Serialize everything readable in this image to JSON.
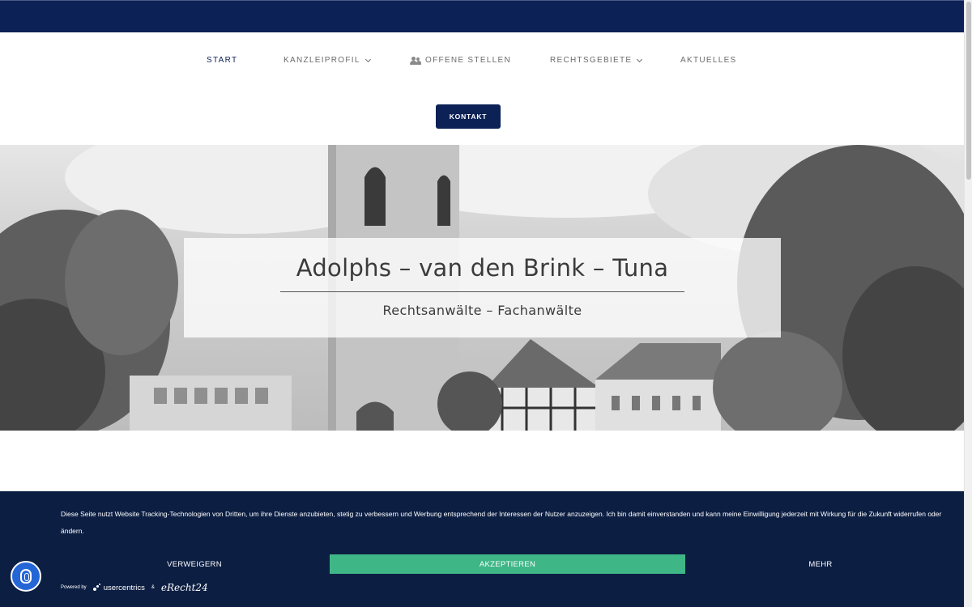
{
  "nav": {
    "items": [
      {
        "label": "START",
        "active": true
      },
      {
        "label": "KANZLEIPROFIL",
        "dropdown": true
      },
      {
        "label": "OFFENE STELLEN",
        "icon": "users-icon"
      },
      {
        "label": "RECHTSGEBIETE",
        "dropdown": true
      },
      {
        "label": "AKTUELLES"
      }
    ],
    "cta": "KONTAKT"
  },
  "hero": {
    "title": "Adolphs – van den Brink – Tuna",
    "subtitle": "Rechtsanwälte – Fachanwälte"
  },
  "cookie": {
    "text": "Diese Seite nutzt Website Tracking-Technologien von Dritten, um ihre Dienste anzubieten, stetig zu verbessern und Werbung entsprechend der Interessen der Nutzer anzuzeigen. Ich bin damit einverstanden und kann meine Einwilligung jederzeit mit Wirkung für die Zukunft widerrufen oder ändern.",
    "deny": "VERWEIGERN",
    "accept": "AKZEPTIEREN",
    "more": "MEHR",
    "powered_by": "Powered by",
    "brand1": "usercentrics",
    "amp": "&",
    "brand2": "eRecht24"
  },
  "colors": {
    "brand": "#0c2156",
    "accept": "#3fb686",
    "banner": "#0c1e42",
    "privacy_button": "#2566d6"
  }
}
